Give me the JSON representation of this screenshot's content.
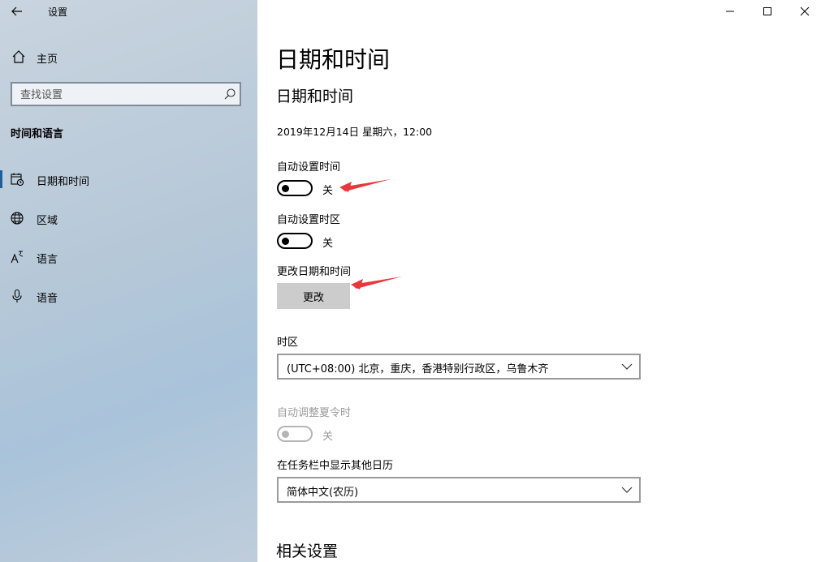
{
  "window": {
    "title": "设置",
    "controls": {
      "minimize": "minimize-icon",
      "maximize": "maximize-icon",
      "close": "close-icon"
    }
  },
  "sidebar": {
    "home_label": "主页",
    "search_placeholder": "查找设置",
    "section_title": "时间和语言",
    "items": [
      {
        "label": "日期和时间",
        "icon": "calendar-clock-icon",
        "active": true
      },
      {
        "label": "区域",
        "icon": "globe-icon",
        "active": false
      },
      {
        "label": "语言",
        "icon": "language-icon",
        "active": false
      },
      {
        "label": "语音",
        "icon": "microphone-icon",
        "active": false
      }
    ]
  },
  "main": {
    "page_title": "日期和时间",
    "section_title": "日期和时间",
    "current_datetime": "2019年12月14日 星期六，12:00",
    "auto_time": {
      "label": "自动设置时间",
      "state": "关"
    },
    "auto_timezone": {
      "label": "自动设置时区",
      "state": "关"
    },
    "change_datetime": {
      "label": "更改日期和时间",
      "button": "更改"
    },
    "timezone": {
      "label": "时区",
      "value": "(UTC+08:00) 北京，重庆，香港特别行政区，乌鲁木齐"
    },
    "dst": {
      "label": "自动调整夏令时",
      "state": "关"
    },
    "taskbar_calendar": {
      "label": "在任务栏中显示其他日历",
      "value": "简体中文(农历)"
    },
    "related_title": "相关设置"
  },
  "colors": {
    "accent": "#1e5f9a",
    "annotation_arrow": "#e8383d"
  }
}
